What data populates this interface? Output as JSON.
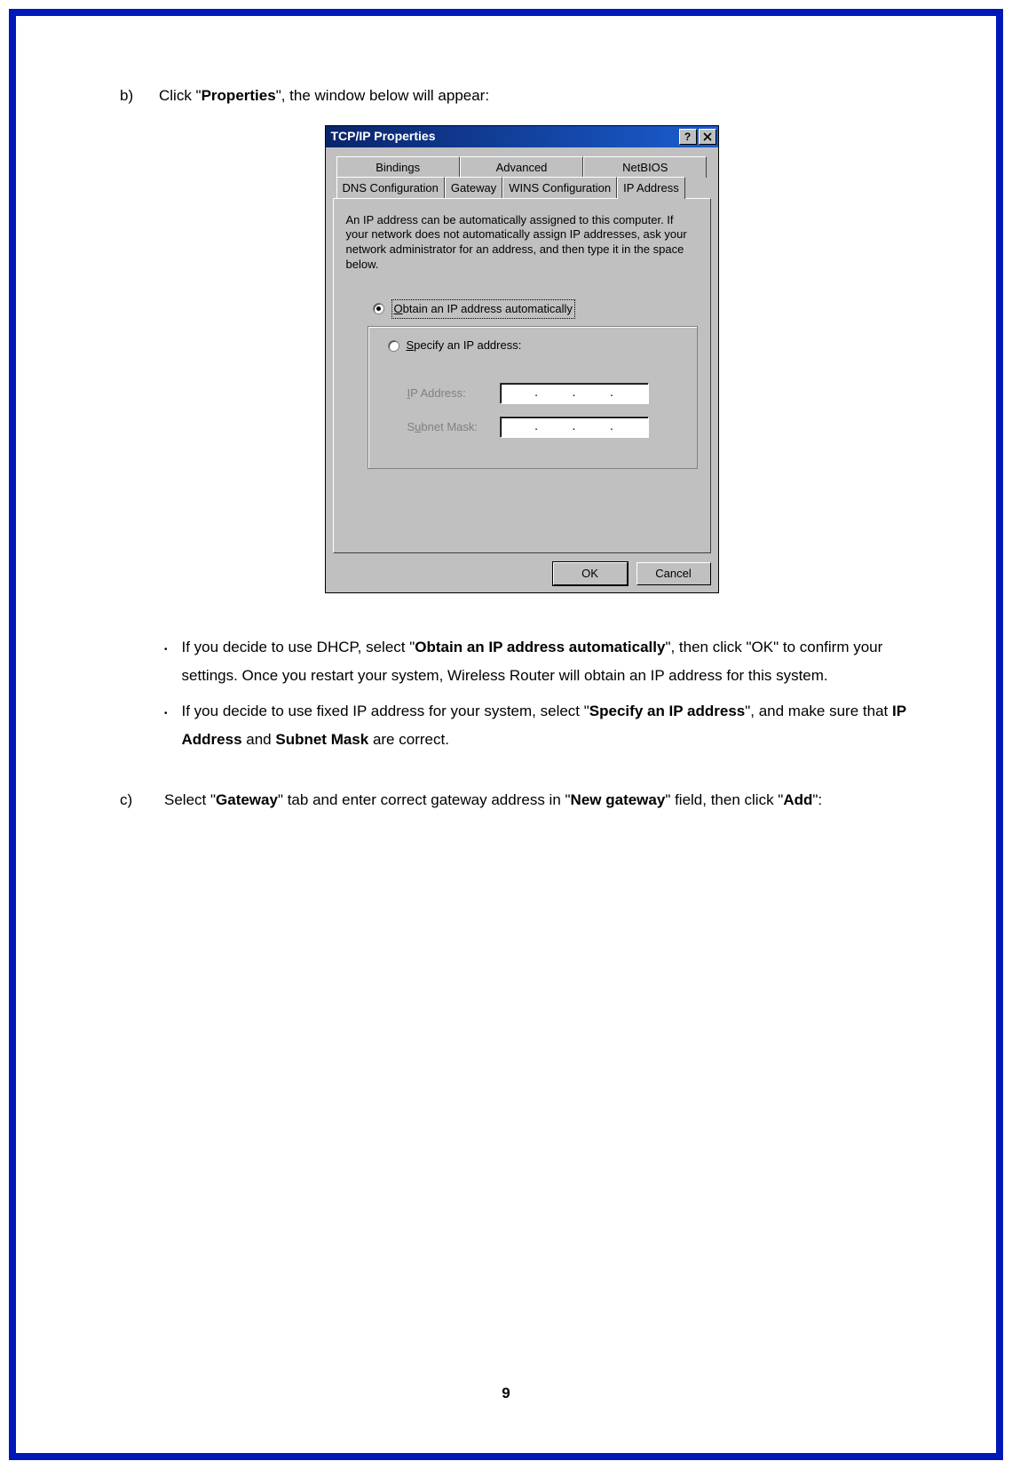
{
  "sections": {
    "b_label": "b)",
    "b_text_pre": "Click \"",
    "b_text_bold": "Properties",
    "b_text_post": "\", the window below will appear:",
    "c_label": "c)",
    "c_pre": "Select \"",
    "c_b1": "Gateway",
    "c_mid": "\" tab and enter correct gateway address in \"",
    "c_b2": "New gateway",
    "c_post1": "\" field, then click \"",
    "c_b3": "Add",
    "c_post2": "\":"
  },
  "bullets": {
    "b1_pre": "If you decide to use DHCP, select \"",
    "b1_bold": "Obtain an IP address automatically",
    "b1_post": "\", then click \"OK\" to confirm your settings.    Once you restart your system, Wireless Router will obtain an IP address for this system.",
    "b2_pre": "If you decide to use fixed IP address for your system, select \"",
    "b2_bold": "Specify an IP address",
    "b2_mid": "\", and make sure that ",
    "b2_bold2": "IP Address",
    "b2_and": " and ",
    "b2_bold3": "Subnet Mask",
    "b2_post": " are correct."
  },
  "dialog": {
    "title": "TCP/IP Properties",
    "tabs_back": [
      "Bindings",
      "Advanced",
      "NetBIOS"
    ],
    "tabs_front": [
      "DNS Configuration",
      "Gateway",
      "WINS Configuration",
      "IP Address"
    ],
    "active_tab": "IP Address",
    "description": "An IP address can be automatically assigned to this computer. If your network does not automatically assign IP addresses, ask your network administrator for an address, and then type it in the space below.",
    "radio_auto_accel": "O",
    "radio_auto_rest": "btain an IP address automatically",
    "radio_spec_accel": "S",
    "radio_spec_rest": "pecify an IP address:",
    "field_ip_accel": "I",
    "field_ip_rest": "P Address:",
    "field_mask_pre": "S",
    "field_mask_accel": "u",
    "field_mask_rest": "bnet Mask:",
    "ok": "OK",
    "cancel": "Cancel"
  },
  "page_number": "9"
}
